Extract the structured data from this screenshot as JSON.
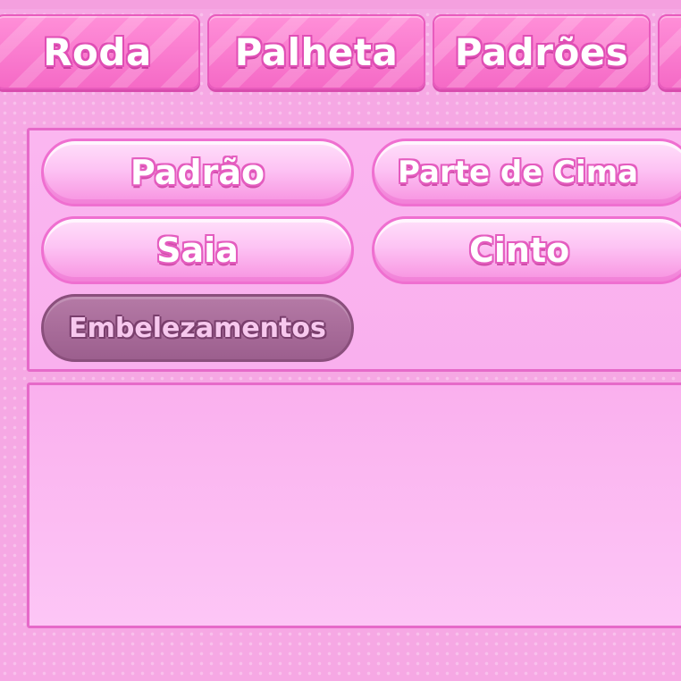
{
  "tabs": [
    {
      "label": "Roda"
    },
    {
      "label": "Palheta"
    },
    {
      "label": "Padrões"
    }
  ],
  "categories": [
    {
      "label": "Padrão",
      "selected": false
    },
    {
      "label": "Parte de Cima",
      "selected": false
    },
    {
      "label": "Saia",
      "selected": false
    },
    {
      "label": "Cinto",
      "selected": false
    },
    {
      "label": "Embelezamentos",
      "selected": true
    }
  ],
  "colors": {
    "background": "#f6a8e4",
    "tab": "#f56ac6",
    "panel_border": "#e66ac9",
    "button": "#fdc3f4",
    "selected_button": "#9c5f8e"
  }
}
